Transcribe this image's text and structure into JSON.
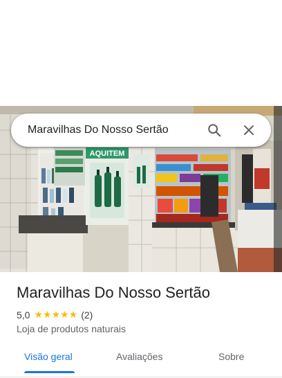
{
  "search": {
    "query": "Maravilhas Do Nosso Sertão"
  },
  "place": {
    "name": "Maravilhas Do Nosso Sertão",
    "rating": "5,0",
    "stars": "★★★★★",
    "reviews_count": "(2)",
    "category": "Loja de produtos naturais"
  },
  "photo": {
    "banner_text": "AQUITEM"
  },
  "tabs": [
    {
      "label": "Visão geral",
      "active": true
    },
    {
      "label": "Avaliações",
      "active": false
    },
    {
      "label": "Sobre",
      "active": false
    }
  ],
  "colors": {
    "accent": "#1a73e8",
    "star": "#fbbc04",
    "text": "#202124",
    "muted": "#5f6368"
  }
}
